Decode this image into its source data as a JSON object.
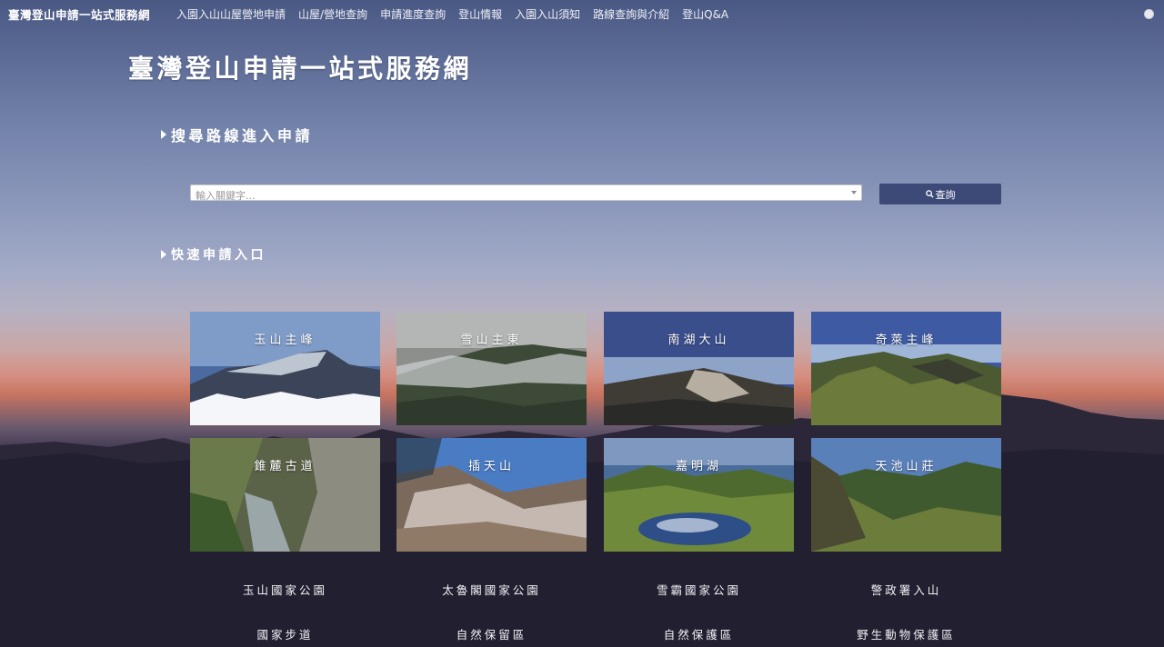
{
  "nav": {
    "brand": "臺灣登山申請一站式服務網",
    "items": [
      "入園入山山屋營地申請",
      "山屋/營地查詢",
      "申請進度查詢",
      "登山情報",
      "入園入山須知",
      "路線查詢與介紹",
      "登山Q&A"
    ]
  },
  "page": {
    "title": "臺灣登山申請一站式服務網"
  },
  "search_section": {
    "heading": "搜尋路線進入申請",
    "placeholder": "輸入關鍵字...",
    "button_label": "查詢"
  },
  "quick_section": {
    "heading": "快速申請入口",
    "tiles": [
      {
        "label": "玉山主峰"
      },
      {
        "label": "雪山主東"
      },
      {
        "label": "南湖大山"
      },
      {
        "label": "奇萊主峰"
      },
      {
        "label": "錐麓古道"
      },
      {
        "label": "插天山"
      },
      {
        "label": "嘉明湖"
      },
      {
        "label": "天池山莊"
      }
    ]
  },
  "links": {
    "row1": [
      "玉山國家公園",
      "太魯閣國家公園",
      "雪霸國家公園",
      "警政署入山"
    ],
    "row2": [
      "國家步道",
      "自然保留區",
      "自然保護區",
      "野生動物保護區"
    ]
  }
}
